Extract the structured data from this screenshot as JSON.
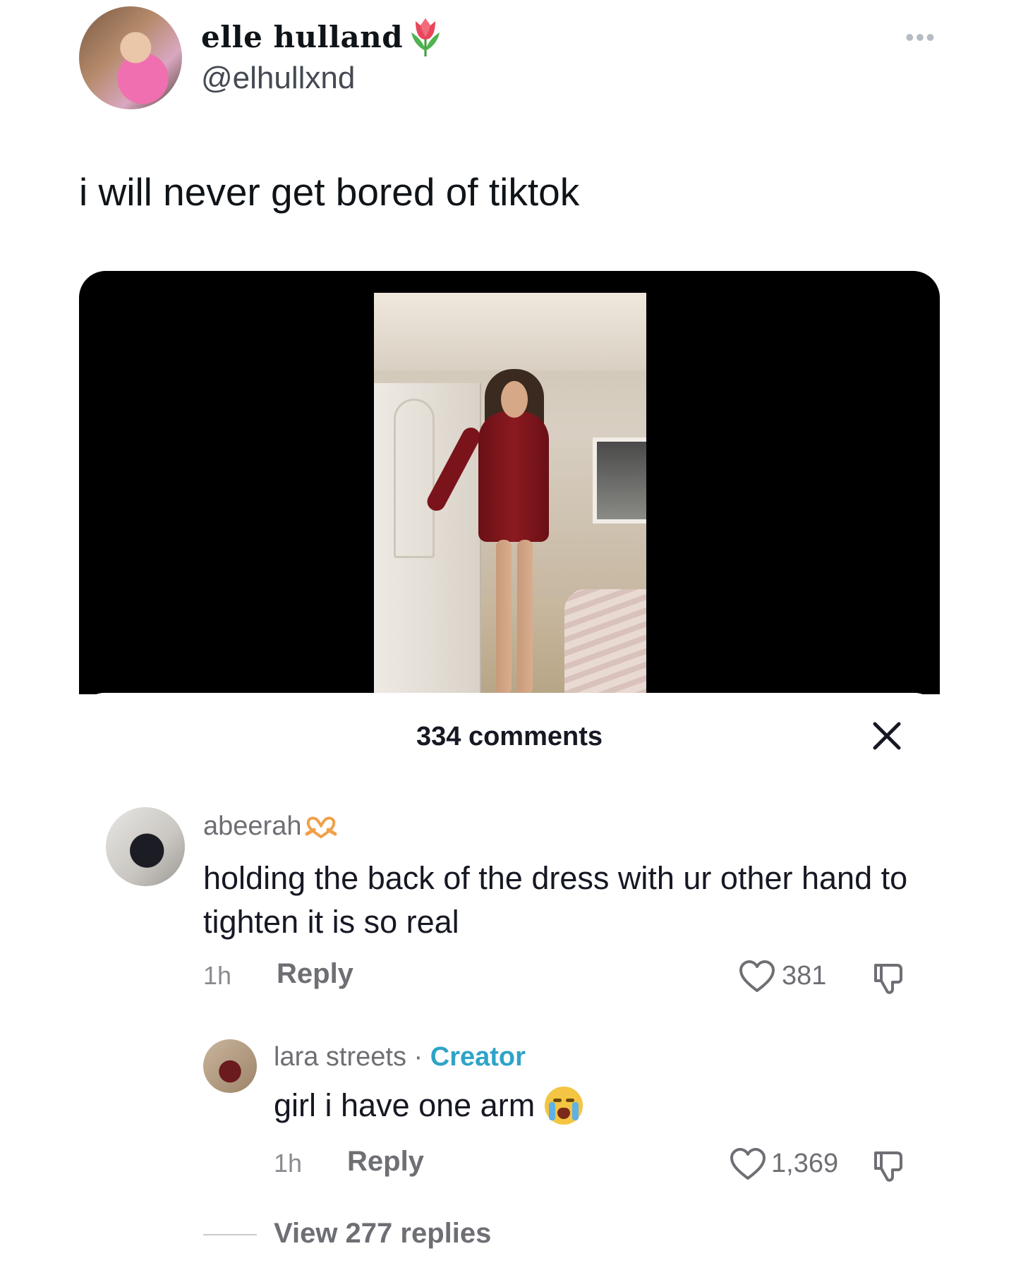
{
  "tweet": {
    "display_name": "elle hulland",
    "name_emoji_icon": "tulip-icon",
    "handle": "@elhullxnd",
    "text": "i will never get bored of tiktok",
    "more_icon": "more-options-icon"
  },
  "embed": {
    "comment_count": "334 comments",
    "close_icon": "close-icon",
    "comments": [
      {
        "username": "abeerah",
        "username_icon": "heart-hands-icon",
        "text": "holding the back of the dress with ur other hand to tighten it is so real",
        "time": "1h",
        "reply_label": "Reply",
        "likes": "381"
      },
      {
        "username": "lara streets",
        "separator": " · ",
        "badge": "Creator",
        "text": "girl i have one arm",
        "text_emoji_icon": "loudly-crying-face-icon",
        "time": "1h",
        "reply_label": "Reply",
        "likes": "1,369"
      }
    ],
    "view_replies": "View 277 replies"
  },
  "colors": {
    "creator_badge": "#2fa3c7",
    "text_primary": "#161823",
    "text_secondary": "#6e6f74",
    "media_background": "#000000"
  }
}
